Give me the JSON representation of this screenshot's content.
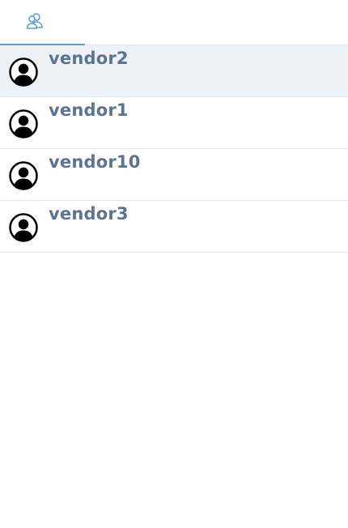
{
  "tabs": [
    {
      "icon": "users-icon",
      "active": true
    }
  ],
  "contacts": [
    {
      "name": "vendor2",
      "selected": true
    },
    {
      "name": "vendor1",
      "selected": false
    },
    {
      "name": "vendor10",
      "selected": false
    },
    {
      "name": "vendor3",
      "selected": false
    }
  ],
  "colors": {
    "accent": "#5b9bd5",
    "name_text": "#5b748f",
    "selected_bg": "#eef2f6",
    "divider": "#e6e9ec"
  }
}
